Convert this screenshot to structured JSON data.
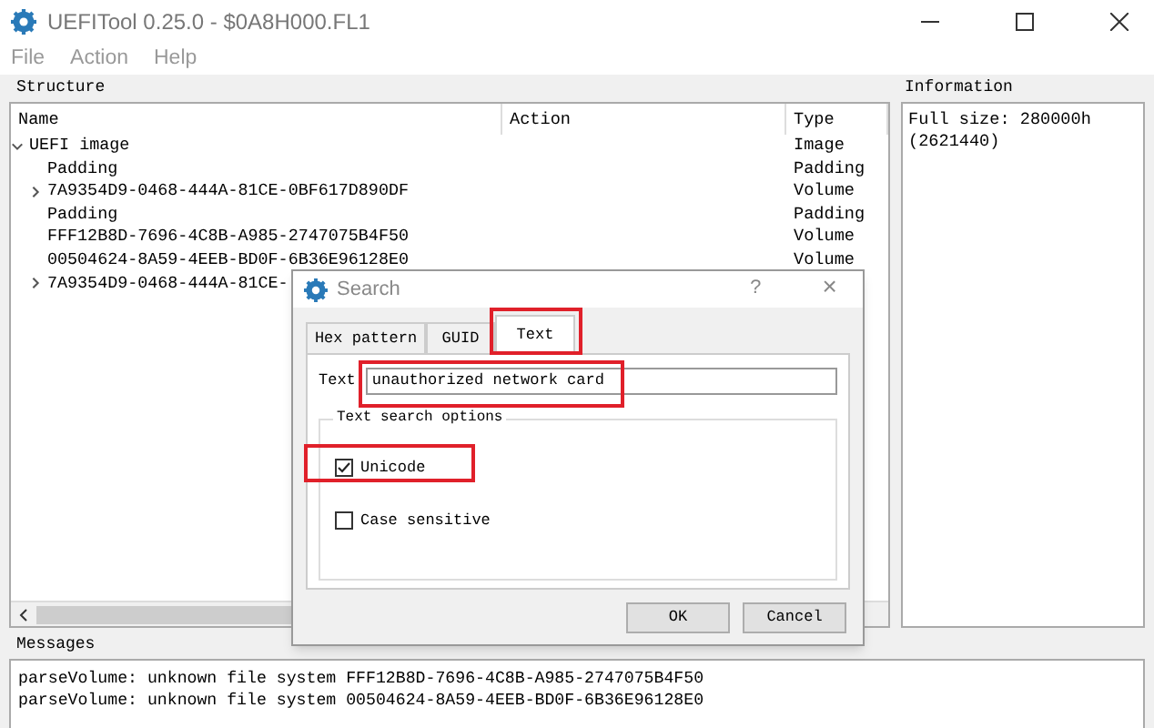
{
  "window": {
    "title": "UEFITool 0.25.0 - $0A8H000.FL1"
  },
  "menu": [
    "File",
    "Action",
    "Help"
  ],
  "structure": {
    "title": "Structure",
    "columns": [
      "Name",
      "Action",
      "Type"
    ],
    "rows": [
      {
        "name": "UEFI image",
        "type": "Image",
        "expandable": true,
        "expanded": true,
        "children": [
          {
            "name": "Padding",
            "type": "Padding",
            "expandable": false
          },
          {
            "name": "7A9354D9-0468-444A-81CE-0BF617D890DF",
            "type": "Volume",
            "expandable": true,
            "expanded": false
          },
          {
            "name": "Padding",
            "type": "Padding",
            "expandable": false
          },
          {
            "name": "FFF12B8D-7696-4C8B-A985-2747075B4F50",
            "type": "Volume",
            "expandable": false
          },
          {
            "name": "00504624-8A59-4EEB-BD0F-6B36E96128E0",
            "type": "Volume",
            "expandable": false
          },
          {
            "name": "7A9354D9-0468-444A-81CE-",
            "expandable": true,
            "expanded": false
          }
        ]
      }
    ]
  },
  "information": {
    "title": "Information",
    "lines": [
      "Full size: 280000h",
      "(2621440)"
    ]
  },
  "messages": {
    "title": "Messages",
    "lines": [
      "parseVolume: unknown file system FFF12B8D-7696-4C8B-A985-2747075B4F50",
      "parseVolume: unknown file system 00504624-8A59-4EEB-BD0F-6B36E96128E0"
    ]
  },
  "dialog": {
    "title": "Search",
    "help": "?",
    "close": "×",
    "tabs": [
      {
        "label": "Hex pattern",
        "selected": false
      },
      {
        "label": "GUID",
        "selected": false
      },
      {
        "label": "Text",
        "selected": true
      }
    ],
    "text_label": "Text",
    "text_value": "unauthorized network card",
    "options_title": "Text search options",
    "options": [
      {
        "label": "Unicode",
        "checked": true
      },
      {
        "label": "Case sensitive",
        "checked": false
      }
    ],
    "buttons": [
      "OK",
      "Cancel"
    ]
  }
}
